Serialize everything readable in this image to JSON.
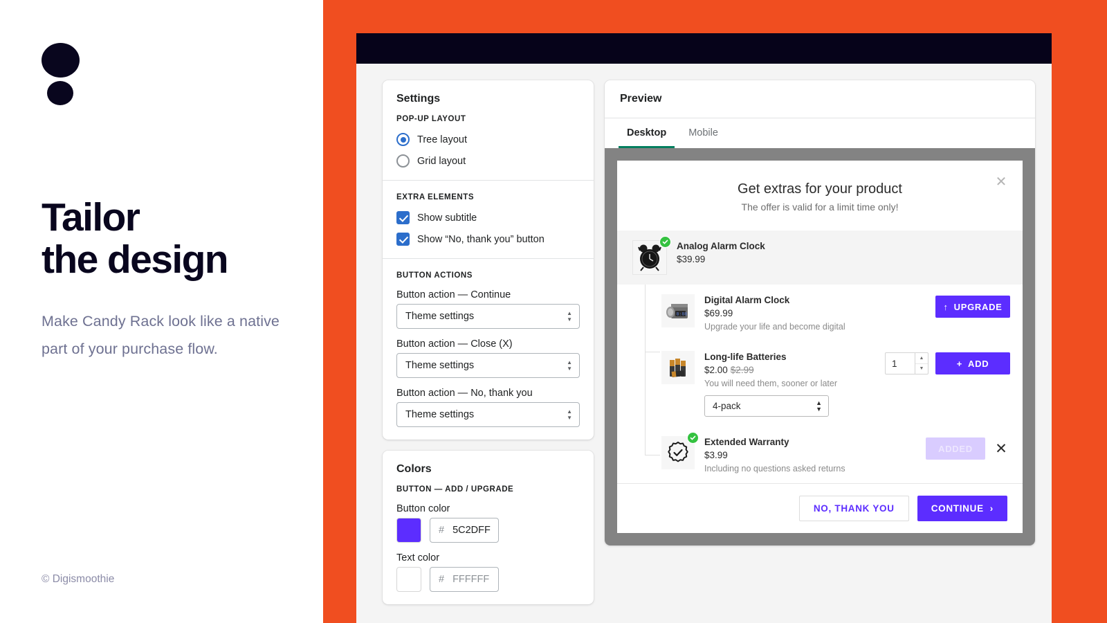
{
  "left": {
    "logo_name": "digismoothie-logo",
    "headline_line1": "Tailor",
    "headline_line2": "the design",
    "subheadline": "Make Candy Rack look like a native part of your purchase flow.",
    "copyright": "© Digismoothie"
  },
  "colors": {
    "stage_orange": "#F04E20",
    "topbar_dark": "#06031A",
    "accent_blue": "#2C6ECB",
    "tab_green": "#007F5F",
    "brand_purple": "#5C2DFF",
    "badge_green": "#34C240",
    "device_gray": "#838383"
  },
  "settings": {
    "title": "Settings",
    "popup_layout": {
      "label": "POP-UP LAYOUT",
      "options": [
        {
          "label": "Tree layout",
          "checked": true
        },
        {
          "label": "Grid layout",
          "checked": false
        }
      ]
    },
    "extra_elements": {
      "label": "EXTRA ELEMENTS",
      "options": [
        {
          "label": "Show subtitle",
          "checked": true
        },
        {
          "label": "Show “No, thank you” button",
          "checked": true
        }
      ]
    },
    "button_actions": {
      "label": "BUTTON ACTIONS",
      "fields": [
        {
          "label": "Button action — Continue",
          "value": "Theme settings"
        },
        {
          "label": "Button action — Close (X)",
          "value": "Theme settings"
        },
        {
          "label": "Button action — No, thank you",
          "value": "Theme settings"
        }
      ]
    }
  },
  "colors_card": {
    "title": "Colors",
    "group_label": "BUTTON — ADD / UPGRADE",
    "button_color": {
      "label": "Button color",
      "hash": "#",
      "hex": "5C2DFF",
      "swatch": "#5C2DFF"
    },
    "text_color": {
      "label": "Text color",
      "hash": "#",
      "hex": "FFFFFF",
      "swatch": "#FFFFFF"
    }
  },
  "preview": {
    "title": "Preview",
    "tabs": [
      {
        "label": "Desktop",
        "active": true
      },
      {
        "label": "Mobile",
        "active": false
      }
    ]
  },
  "popup": {
    "title": "Get extras for your product",
    "subtitle": "The offer is valid for a limit time only!",
    "close_icon": "close-icon",
    "products": [
      {
        "name": "Analog Alarm Clock",
        "price": "$39.99",
        "old_price": "",
        "description": "",
        "level": "parent",
        "selected": true,
        "thumb_icon": "analog-alarm-clock-image",
        "action": {
          "type": "none"
        }
      },
      {
        "name": "Digital Alarm Clock",
        "price": "$69.99",
        "old_price": "",
        "description": "Upgrade your life and become digital",
        "level": "child",
        "selected": false,
        "thumb_icon": "digital-alarm-clock-image",
        "action": {
          "type": "upgrade",
          "label": "UPGRADE",
          "icon": "arrow-up-icon"
        }
      },
      {
        "name": "Long-life Batteries",
        "price": "$2.00",
        "old_price": "$2.99",
        "description": "You will need them, sooner or later",
        "level": "child",
        "selected": false,
        "thumb_icon": "batteries-image",
        "variant": {
          "value": "4-pack"
        },
        "action": {
          "type": "add",
          "label": "ADD",
          "icon": "plus-icon",
          "quantity": "1"
        }
      },
      {
        "name": "Extended Warranty",
        "price": "$3.99",
        "old_price": "",
        "description": "Including no questions asked returns",
        "level": "child",
        "selected": true,
        "thumb_icon": "warranty-badge-icon",
        "action": {
          "type": "added",
          "label": "ADDED",
          "remove_icon": "close-icon"
        }
      }
    ],
    "footer": {
      "secondary_label": "NO, THANK YOU",
      "primary_label": "CONTINUE",
      "primary_icon": "chevron-right-icon"
    }
  }
}
